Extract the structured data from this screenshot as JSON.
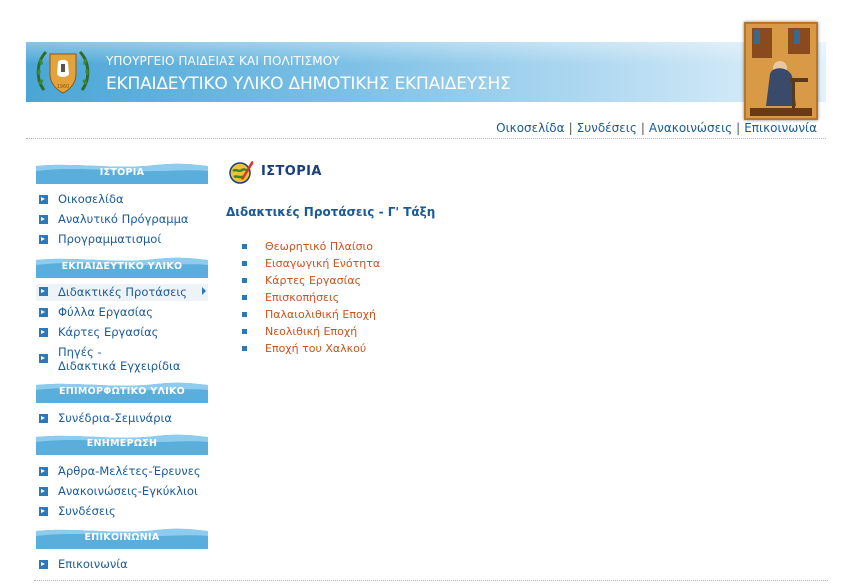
{
  "header": {
    "ministry": "ΥΠΟΥΡΓΕΙΟ ΠΑΙΔΕΙΑΣ ΚΑΙ ΠΟΛΙΤΙΣΜΟΥ",
    "site_title": "ΕΚΠΑΙΔΕΥΤΙΚΟ ΥΛΙΚΟ ΔΗΜΟΤΙΚΗΣ ΕΚΠΑΙΔΕΥΣΗΣ",
    "emblem_icon": "cyprus-coat-of-arms",
    "illustration_icon": "monk-scribe-painting"
  },
  "topnav": {
    "items": [
      "Οικοσελίδα",
      "Συνδέσεις",
      "Ανακοινώσεις",
      "Επικοινωνία"
    ],
    "separator": "|"
  },
  "sidebar": {
    "sections": [
      {
        "title": "ΙΣΤΟΡΙΑ",
        "items": [
          "Οικοσελίδα",
          "Αναλυτικό Πρόγραμμα",
          "Προγραμματισμοί"
        ]
      },
      {
        "title": "ΕΚΠΑΙΔΕΥΤΙΚΟ ΥΛΙΚΟ",
        "items": [
          "Διδακτικές Προτάσεις",
          "Φύλλα Εργασίας",
          "Κάρτες Εργασίας",
          "Πηγές -",
          "Διδακτικά Εγχειρίδια"
        ]
      },
      {
        "title": "ΕΠΙΜΟΡΦΩΤΙΚΟ ΥΛΙΚΟ",
        "items": [
          "Συνέδρια-Σεμινάρια"
        ]
      },
      {
        "title": "ΕΝΗΜΕΡΩΣΗ",
        "items": [
          "Άρθρα-Μελέτες-Έρευνες",
          "Ανακοινώσεις-Εγκύκλιοι",
          "Συνδέσεις"
        ]
      },
      {
        "title": "ΕΠΙΚΟΙΝΩΝΙΑ",
        "items": [
          "Επικοινωνία"
        ]
      }
    ],
    "active_item": "Διδακτικές Προτάσεις"
  },
  "main": {
    "section_title": "ΙΣΤΟΡΙΑ",
    "section_icon": "quill-globe-icon",
    "heading": "Διδακτικές Προτάσεις - Γ' Τάξη",
    "topics": [
      "Θεωρητικό Πλαίσιο",
      "Εισαγωγική Ενότητα",
      "Κάρτες Εργασίας",
      "Επισκοπήσεις",
      "Παλαιολιθική Εποχή",
      "Νεολιθική Εποχή",
      "Εποχή του Χαλκού"
    ]
  },
  "colors": {
    "banner_start": "#4aa6d6",
    "banner_end": "#e2f1fb",
    "link": "#1a5a9a",
    "topic_link": "#c8531c",
    "section_header": "#5aaedc",
    "bullet": "#2d78b8"
  }
}
